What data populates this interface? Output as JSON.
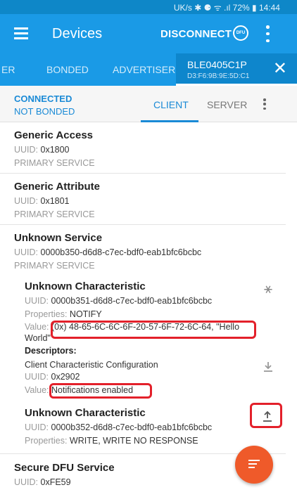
{
  "status_bar": {
    "text": "UK/s ✱ ⚈ ᯤ .ıl 72% ▮ 14:44"
  },
  "app_bar": {
    "title": "Devices",
    "disconnect_label": "DISCONNECT",
    "dfu_label": "DFU"
  },
  "tabs": {
    "items": [
      "ER",
      "BONDED",
      "ADVERTISER"
    ],
    "device_name": "BLE0405C1P",
    "device_address": "D3:F6:9B:9E:5D:C1",
    "close_glyph": "✕"
  },
  "connection": {
    "state": "CONNECTED",
    "bond": "NOT BONDED"
  },
  "sub_tabs": {
    "client": "CLIENT",
    "server": "SERVER"
  },
  "labels": {
    "uuid": "UUID: ",
    "properties": "Properties: ",
    "value": "Value: ",
    "descriptors": "Descriptors:"
  },
  "services": [
    {
      "name": "Generic Access",
      "uuid": "0x1800",
      "type": "PRIMARY SERVICE"
    },
    {
      "name": "Generic Attribute",
      "uuid": "0x1801",
      "type": "PRIMARY SERVICE"
    },
    {
      "name": "Unknown Service",
      "uuid": "0000b350-d6d8-c7ec-bdf0-eab1bfc6bcbc",
      "type": "PRIMARY SERVICE"
    },
    {
      "name": "Secure DFU Service",
      "uuid": "0xFE59"
    }
  ],
  "characteristics": [
    {
      "name": "Unknown Characteristic",
      "uuid": "0000b351-d6d8-c7ec-bdf0-eab1bfc6bcbc",
      "properties": "NOTIFY",
      "value": "(0x) 48-65-6C-6C-6F-20-57-6F-72-6C-64, \"Hello World\""
    },
    {
      "name": "Unknown Characteristic",
      "uuid": "0000b352-d6d8-c7ec-bdf0-eab1bfc6bcbc",
      "properties": "WRITE, WRITE NO RESPONSE"
    }
  ],
  "descriptor": {
    "name": "Client Characteristic Configuration",
    "uuid": "0x2902",
    "value": "Notifications enabled"
  },
  "colors": {
    "app_bar": "#1a9ae6",
    "accent": "#1a8ad6",
    "highlight": "#e3202a",
    "fab": "#ef5a2a"
  }
}
